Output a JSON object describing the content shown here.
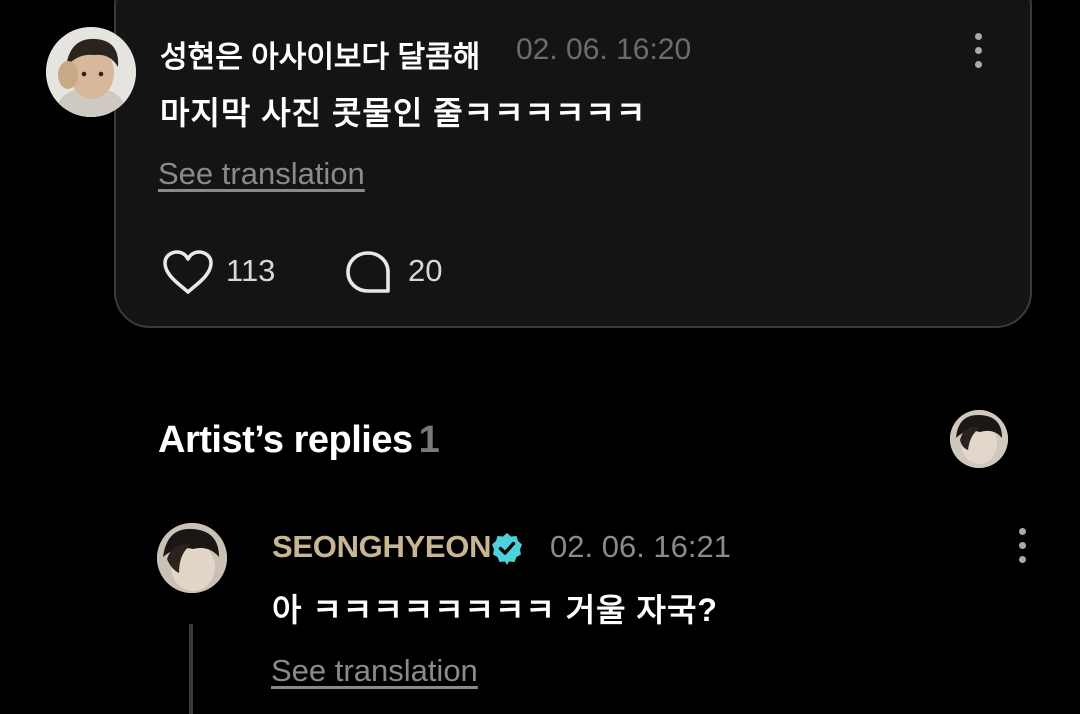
{
  "post": {
    "author": "성현은 아사이보다 달콤해",
    "timestamp": "02. 06. 16:20",
    "text": "마지막 사진 콧물인 줄ㅋㅋㅋㅋㅋㅋ",
    "see_translation": "See translation",
    "like_count": "113",
    "comment_count": "20",
    "more_icon": "vertical-ellipsis-icon",
    "like_icon": "heart-outline-icon",
    "comment_icon": "speech-bubble-icon"
  },
  "artist_replies": {
    "title": "Artist’s replies",
    "count": "1",
    "replies": [
      {
        "author": "SEONGHYEON",
        "verified_icon": "verified-badge-icon",
        "timestamp": "02. 06. 16:21",
        "text": "아 ㅋㅋㅋㅋㅋㅋㅋㅋ 거울 자국?",
        "see_translation": "See translation"
      }
    ]
  },
  "colors": {
    "background": "#000000",
    "card": "#141414",
    "artist_name": "#c8b593",
    "verified": "#4fd1d9",
    "muted": "#8a8a8a"
  }
}
